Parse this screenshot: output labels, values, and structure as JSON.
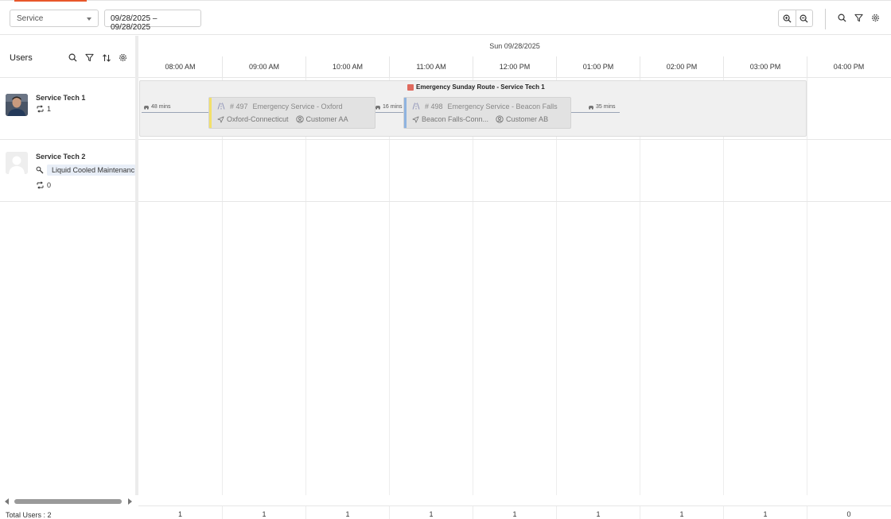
{
  "toolbar": {
    "service_select": "Service",
    "date_range": "09/28/2025 – 09/28/2025"
  },
  "left_panel": {
    "title": "Users",
    "users": [
      {
        "name": "Service Tech 1",
        "route_count": "1",
        "skill": ""
      },
      {
        "name": "Service Tech 2",
        "route_count": "0",
        "skill": "Liquid Cooled Maintenanc"
      }
    ],
    "total_users": "Total Users : 2"
  },
  "timeline": {
    "date_label": "Sun 09/28/2025",
    "hours": [
      "08:00 AM",
      "09:00 AM",
      "10:00 AM",
      "11:00 AM",
      "12:00 PM",
      "01:00 PM",
      "02:00 PM",
      "03:00 PM",
      "04:00 PM"
    ],
    "counts": [
      "1",
      "1",
      "1",
      "1",
      "1",
      "1",
      "1",
      "1",
      "0"
    ],
    "route": {
      "title": "Emergency Sunday Route - Service Tech 1",
      "color": "#e06a5e",
      "travel": [
        "48 mins",
        "16 mins",
        "35 mins"
      ],
      "jobs": [
        {
          "number": "# 497",
          "name": "Emergency Service - Oxford",
          "location": "Oxford-Connecticut",
          "customer": "Customer AA",
          "stripe_color": "#f2e06b"
        },
        {
          "number": "# 498",
          "name": "Emergency Service - Beacon Falls",
          "location": "Beacon Falls-Conn...",
          "customer": "Customer AB",
          "stripe_color": "#8fb3e0"
        }
      ]
    }
  },
  "colors": {
    "accent": "#e8572a"
  },
  "icons": [
    "search-icon",
    "filter-icon",
    "sort-icon",
    "settings-icon",
    "zoom-in-icon",
    "zoom-out-icon",
    "route-icon",
    "wrench-icon",
    "car-icon",
    "road-icon",
    "location-icon",
    "customer-icon"
  ]
}
